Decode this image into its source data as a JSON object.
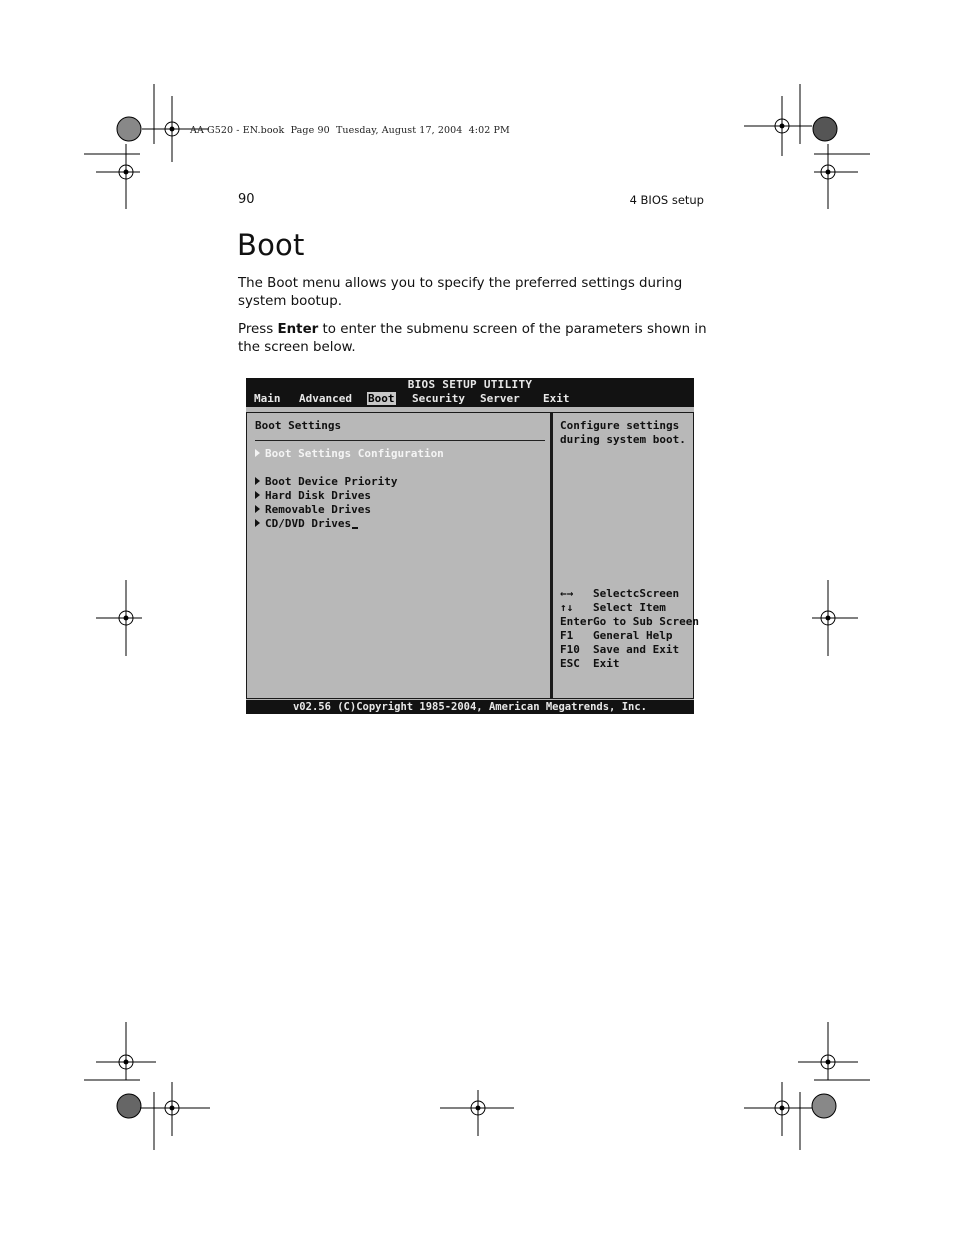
{
  "slug": "AA G520 - EN.book  Page 90  Tuesday, August 17, 2004  4:02 PM",
  "header": {
    "page_number": "90",
    "running_head": "4 BIOS setup"
  },
  "title": "Boot",
  "paragraphs": {
    "p1": "The Boot menu allows you to specify the preferred settings during system bootup.",
    "p2_prefix": "Press ",
    "p2_bold": "Enter",
    "p2_suffix": " to enter the submenu screen of the parameters shown in the screen below."
  },
  "bios": {
    "title": "BIOS SETUP UTILITY",
    "menu": [
      "Main",
      "Advanced",
      "Boot",
      "Security",
      "Server",
      "Exit"
    ],
    "active_menu": "Boot",
    "section_title": "Boot Settings",
    "items": [
      "Boot Settings Configuration",
      "Boot Device Priority",
      "Hard Disk Drives",
      "Removable Drives",
      "CD/DVD Drives"
    ],
    "help_text": [
      "Configure settings",
      "during system boot."
    ],
    "keys": [
      {
        "key": "←→",
        "desc": "SelectcScreen"
      },
      {
        "key": "↑↓",
        "desc": "Select Item"
      },
      {
        "key": "Enter",
        "desc": "Go to Sub Screen"
      },
      {
        "key": "F1",
        "desc": "General Help"
      },
      {
        "key": "F10",
        "desc": "Save and Exit"
      },
      {
        "key": "ESC",
        "desc": "Exit"
      }
    ],
    "footer": "v02.56 (C)Copyright 1985-2004, American Megatrends, Inc."
  },
  "colors": {
    "bios_bar": "#121212",
    "bios_body": "#b8b8b8"
  }
}
